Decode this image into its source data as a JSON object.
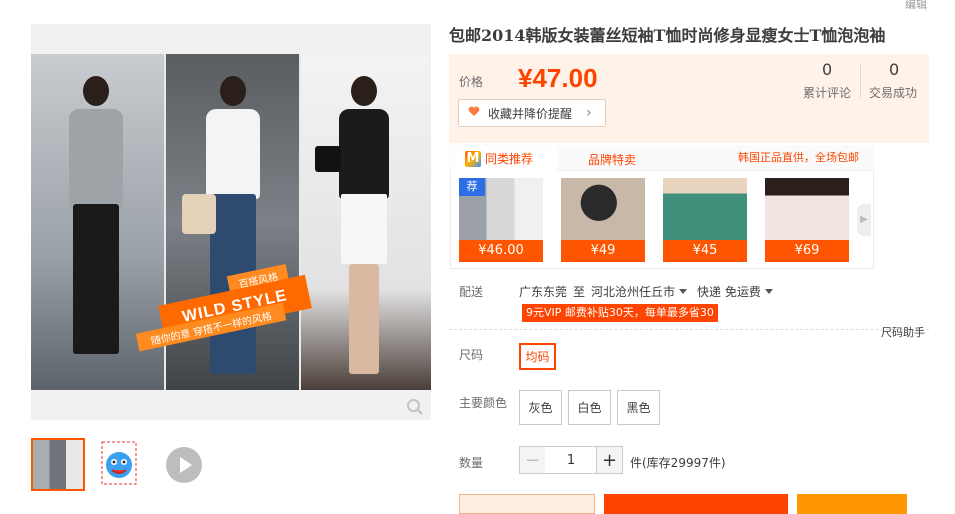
{
  "header": {
    "edit_link": "编辑"
  },
  "product": {
    "title": "包邮2014韩版女装蕾丝短袖T恤时尚修身显瘦女士T恤泡泡袖",
    "price_label": "价格",
    "price": "¥47.00",
    "stats": [
      {
        "value": "0",
        "label": "累计评论"
      },
      {
        "value": "0",
        "label": "交易成功"
      }
    ],
    "favorite_button": "收藏并降价提醒"
  },
  "gallery": {
    "banner_text": "WILD STYLE",
    "banner_tag": "百搭风格",
    "banner_sub": "随你的意 穿搭不一样的风格"
  },
  "recommend": {
    "tabs": [
      "同类推荐",
      "品牌特卖"
    ],
    "tab_icon": "M",
    "note": "韩国正品直供，全场包邮",
    "badge": "荐",
    "items": [
      {
        "price": "¥46.00"
      },
      {
        "price": "¥49"
      },
      {
        "price": "¥45"
      },
      {
        "price": "¥69"
      }
    ]
  },
  "delivery": {
    "label": "配送",
    "from": "广东东莞",
    "to_word": "至",
    "to": "河北沧州任丘市",
    "method": "快递 免运费",
    "vip_note": "9元VIP 邮费补贴30天，每单最多省30"
  },
  "size": {
    "helper": "尺码助手",
    "label": "尺码",
    "options": [
      "均码"
    ]
  },
  "color": {
    "label": "主要颜色",
    "options": [
      "灰色",
      "白色",
      "黑色"
    ]
  },
  "quantity": {
    "label": "数量",
    "minus": "−",
    "value": "1",
    "plus": "+",
    "stock": "件(库存29997件)"
  }
}
